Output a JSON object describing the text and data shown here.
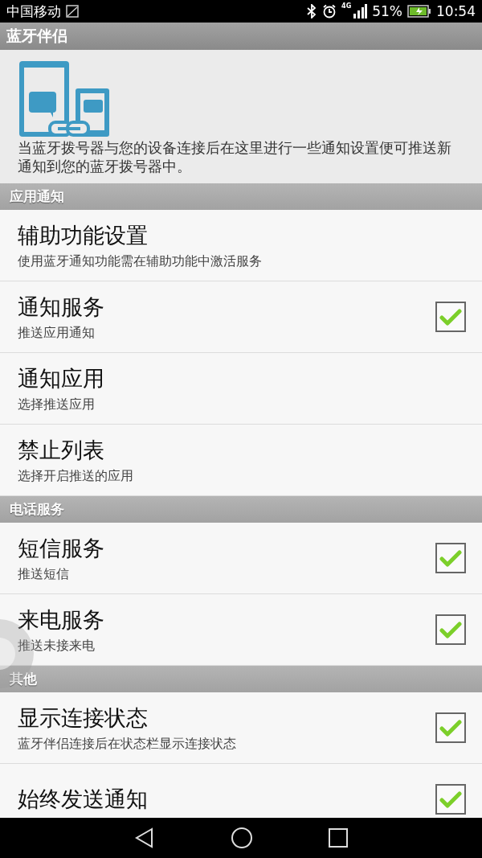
{
  "status_bar": {
    "carrier": "中国移动",
    "network": "4G",
    "battery": "51%",
    "time": "10:54"
  },
  "title": "蓝牙伴侣",
  "intro": "当蓝牙拨号器与您的设备连接后在这里进行一些通知设置便可推送新通知到您的蓝牙拨号器中。",
  "sections": [
    {
      "header": "应用通知",
      "items": [
        {
          "kind": "link",
          "title": "辅助功能设置",
          "subtitle": "使用蓝牙通知功能需在辅助功能中激活服务"
        },
        {
          "kind": "check",
          "title": "通知服务",
          "subtitle": "推送应用通知",
          "checked": true
        },
        {
          "kind": "link",
          "title": "通知应用",
          "subtitle": "选择推送应用"
        },
        {
          "kind": "link",
          "title": "禁止列表",
          "subtitle": "选择开启推送的应用"
        }
      ]
    },
    {
      "header": "电话服务",
      "items": [
        {
          "kind": "check",
          "title": "短信服务",
          "subtitle": "推送短信",
          "checked": true
        },
        {
          "kind": "check",
          "title": "来电服务",
          "subtitle": "推送未接来电",
          "checked": true
        }
      ]
    },
    {
      "header": "其他",
      "items": [
        {
          "kind": "check",
          "title": "显示连接状态",
          "subtitle": "蓝牙伴侣连接后在状态栏显示连接状态",
          "checked": true
        },
        {
          "kind": "check",
          "title": "始终发送通知",
          "checked": true
        }
      ]
    }
  ]
}
